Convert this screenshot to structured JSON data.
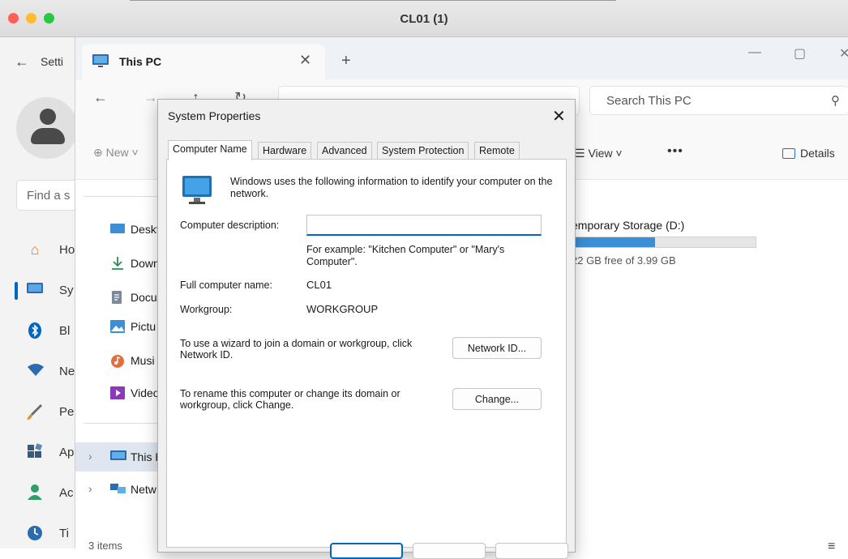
{
  "host": {
    "title": "CL01 (1)",
    "traffic_colors": [
      "#ff5f57",
      "#febc2e",
      "#28c840"
    ]
  },
  "settings": {
    "back_label": "Setti",
    "search_placeholder": "Find a s",
    "nav": [
      {
        "label": "Ho",
        "icon": "home-icon",
        "color": "#e07b2a"
      },
      {
        "label": "Sy",
        "icon": "monitor-icon",
        "color": "#2b6cb0",
        "active": true
      },
      {
        "label": "Bl",
        "icon": "bluetooth-icon",
        "color": "#0067c0"
      },
      {
        "label": "Ne",
        "icon": "wifi-icon",
        "color": "#2b6cb0"
      },
      {
        "label": "Pe",
        "icon": "brush-icon",
        "color": "#e08a2a"
      },
      {
        "label": "Ap",
        "icon": "apps-icon",
        "color": "#3a5a7a"
      },
      {
        "label": "Ac",
        "icon": "person-icon",
        "color": "#2e9e6a"
      },
      {
        "label": "Ti",
        "icon": "clock-icon",
        "color": "#2b6cb0"
      }
    ]
  },
  "explorer": {
    "tab_title": "This PC",
    "close_glyph": "✕",
    "new_tab_glyph": "+",
    "back_glyph": "←",
    "forward_glyph": "→",
    "search_placeholder": "Search This PC",
    "new_label": "New",
    "view_label": "View",
    "more_label": "•••",
    "details_label": "Details",
    "nav_items": [
      {
        "label": "Deskt",
        "icon": "desktop-icon"
      },
      {
        "label": "Down",
        "icon": "download-icon"
      },
      {
        "label": "Docu",
        "icon": "document-icon"
      },
      {
        "label": "Pictu",
        "icon": "picture-icon"
      },
      {
        "label": "Musi",
        "icon": "music-icon"
      },
      {
        "label": "Video",
        "icon": "video-icon"
      }
    ],
    "tree_items": [
      {
        "label": "This P",
        "icon": "this-pc-icon",
        "selected": true
      },
      {
        "label": "Netw",
        "icon": "network-icon"
      }
    ],
    "drive": {
      "label": "emporary Storage (D:)",
      "free_text": "22 GB free of 3.99 GB",
      "used_fraction": 0.45
    },
    "status_text": "3 items"
  },
  "dialog": {
    "title": "System Properties",
    "close_glyph": "✕",
    "tabs": [
      "Computer Name",
      "Hardware",
      "Advanced",
      "System Protection",
      "Remote"
    ],
    "active_tab": 0,
    "intro_text": "Windows uses the following information to identify your computer on the network.",
    "description_label": "Computer description:",
    "description_value": "",
    "example_text": "For example: \"Kitchen Computer\" or \"Mary's Computer\".",
    "full_name_label": "Full computer name:",
    "full_name_value": "CL01",
    "workgroup_label": "Workgroup:",
    "workgroup_value": "WORKGROUP",
    "network_text": "To use a wizard to join a domain or workgroup, click Network ID.",
    "network_button": "Network ID...",
    "rename_text": "To rename this computer or change its domain or workgroup, click Change.",
    "change_button": "Change..."
  }
}
